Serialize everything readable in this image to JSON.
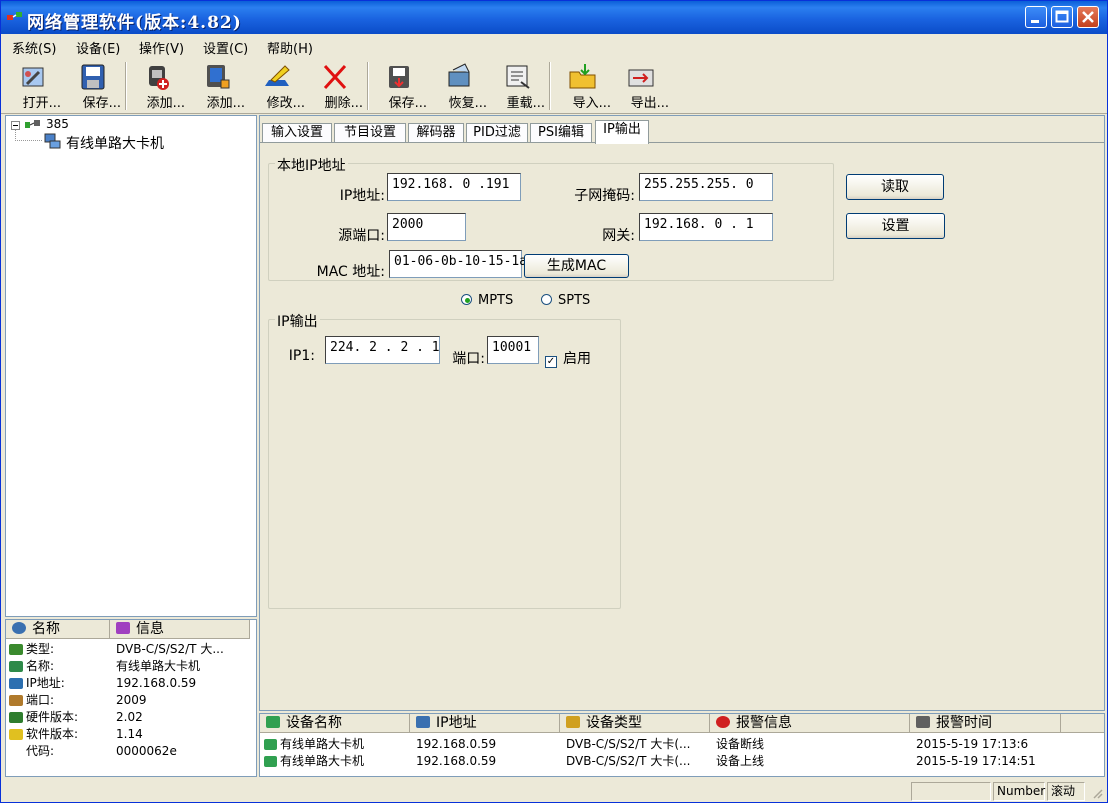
{
  "window": {
    "title": "网络管理软件(版本:4.82)"
  },
  "menu": {
    "items": [
      "系统(S)",
      "设备(E)",
      "操作(V)",
      "设置(C)",
      "帮助(H)"
    ]
  },
  "toolbar": {
    "buttons": [
      "打开...",
      "保存...",
      "添加...",
      "添加...",
      "修改...",
      "删除...",
      "保存...",
      "恢复...",
      "重载...",
      "导入...",
      "导出..."
    ]
  },
  "tree": {
    "root": "385",
    "child": "有线单路大卡机"
  },
  "info": {
    "headers": [
      "名称",
      "信息"
    ],
    "rows": [
      {
        "key": "类型:",
        "value": "DVB-C/S/S2/T 大...",
        "icon": "device-type-icon",
        "color": "#3a8a2e"
      },
      {
        "key": "名称:",
        "value": "有线单路大卡机",
        "icon": "name-icon",
        "color": "#2e8a4a"
      },
      {
        "key": "IP地址:",
        "value": "192.168.0.59",
        "icon": "ip-icon",
        "color": "#2c6fb0"
      },
      {
        "key": "端口:",
        "value": "2009",
        "icon": "port-icon",
        "color": "#b07a2c"
      },
      {
        "key": "硬件版本:",
        "value": "2.02",
        "icon": "hardware-icon",
        "color": "#2e7d2e"
      },
      {
        "key": "软件版本:",
        "value": "1.14",
        "icon": "software-icon",
        "color": "#e0c020"
      },
      {
        "key": "代码:",
        "value": "0000062e",
        "icon": "",
        "color": "#ffffff"
      }
    ]
  },
  "tabs": {
    "items": [
      "输入设置",
      "节目设置",
      "解码器",
      "PID过滤",
      "PSI编辑",
      "IP输出"
    ],
    "active": 5
  },
  "local_ip": {
    "title": "本地IP地址",
    "ip_label": "IP地址:",
    "ip": "192.168. 0 .191",
    "subnet_label": "子网掩码:",
    "subnet": "255.255.255. 0",
    "port_label": "源端口:",
    "port": "2000",
    "gateway_label": "网关:",
    "gateway": "192.168. 0 . 1",
    "mac_label": "MAC 地址:",
    "mac": "01-06-0b-10-15-1a",
    "gen_mac": "生成MAC"
  },
  "buttons": {
    "read": "读取",
    "set": "设置"
  },
  "stream_mode": {
    "mpts": "MPTS",
    "spts": "SPTS",
    "selected": "MPTS"
  },
  "ip_output": {
    "title": "IP输出",
    "ip1_label": "IP1:",
    "ip1": "224. 2 . 2 . 1",
    "port_label": "端口:",
    "port": "10001",
    "enable_label": "启用",
    "enabled": true
  },
  "alarm": {
    "headers": [
      "设备名称",
      "IP地址",
      "设备类型",
      "报警信息",
      "报警时间"
    ],
    "rows": [
      [
        "有线单路大卡机",
        "192.168.0.59",
        "DVB-C/S/S2/T 大卡(...",
        "设备断线",
        "2015-5-19 17:13:6"
      ],
      [
        "有线单路大卡机",
        "192.168.0.59",
        "DVB-C/S/S2/T 大卡(...",
        "设备上线",
        "2015-5-19 17:14:51"
      ]
    ]
  },
  "status": {
    "number": "Number",
    "scroll": "滚动"
  }
}
